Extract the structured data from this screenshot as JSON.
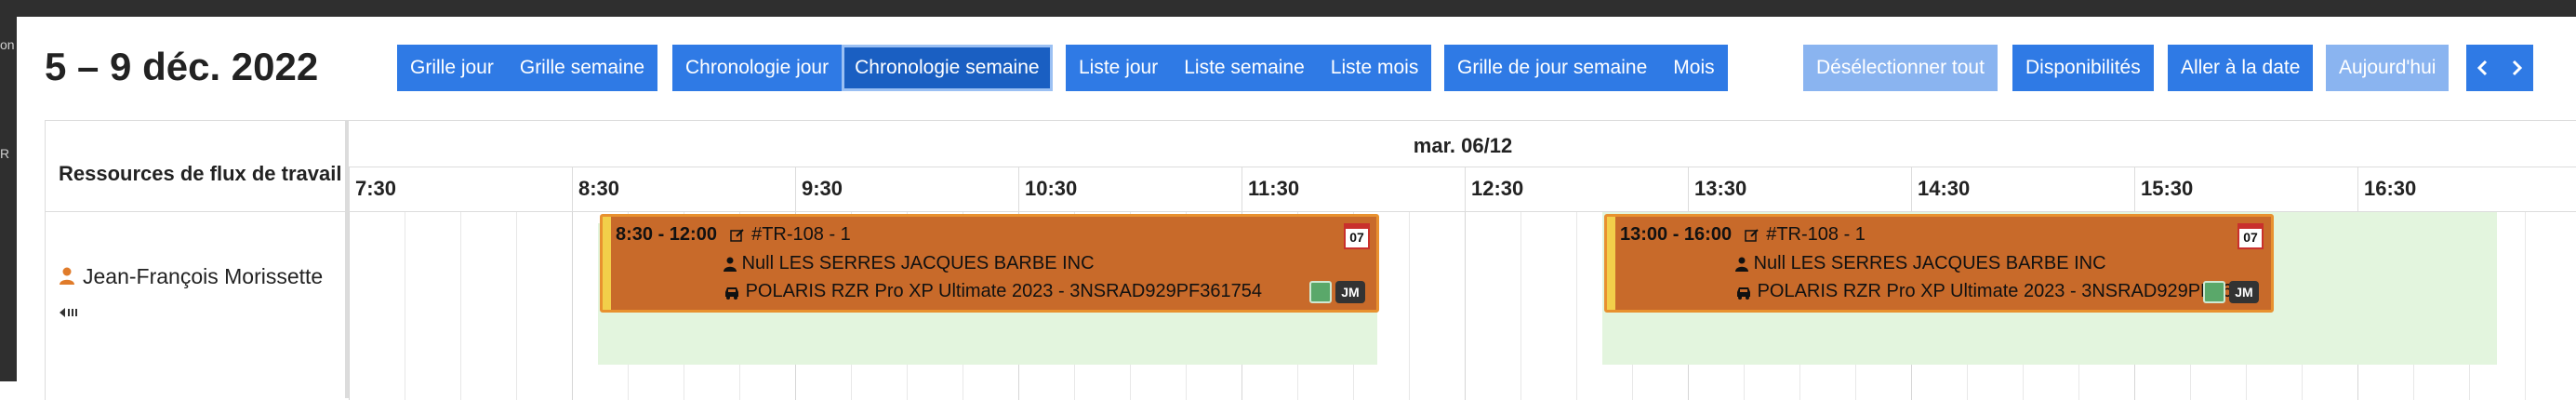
{
  "frame": {
    "left_text_top": "on",
    "left_text_mid": "R"
  },
  "header": {
    "title": "5 – 9 déc. 2022"
  },
  "toolbar": {
    "grille_jour": "Grille jour",
    "grille_semaine": "Grille semaine",
    "chrono_jour": "Chronologie jour",
    "chrono_semaine": "Chronologie semaine",
    "liste_jour": "Liste jour",
    "liste_semaine": "Liste semaine",
    "liste_mois": "Liste mois",
    "grille_jour_semaine": "Grille de jour semaine",
    "mois": "Mois",
    "deselect_all": "Désélectionner tout",
    "disponibilites": "Disponibilités",
    "aller_date": "Aller à la date",
    "aujourdhui": "Aujourd'hui",
    "prev_icon": "chevron-left-icon",
    "next_icon": "chevron-right-icon"
  },
  "calendar": {
    "resource_header": "Ressources de flux de travail",
    "day_label": "mar. 06/12",
    "hours": [
      "7:30",
      "8:30",
      "9:30",
      "10:30",
      "11:30",
      "12:30",
      "13:30",
      "14:30",
      "15:30",
      "16:30"
    ],
    "resource": {
      "name": "Jean-François Morissette",
      "icon": "user-icon",
      "sub_icon": "arrow-left-bars-icon"
    },
    "events": [
      {
        "time": "8:30 - 12:00",
        "ref": "#TR-108 - 1",
        "customer": "Null LES SERRES JACQUES BARBE INC",
        "vehicle": "POLARIS RZR Pro XP Ultimate 2023 - 3NSRAD929PF361754",
        "day_badge": "07",
        "initials": "JM"
      },
      {
        "time": "13:00 - 16:00",
        "ref": "#TR-108 - 1",
        "customer": "Null LES SERRES JACQUES BARBE INC",
        "vehicle": "POLARIS RZR Pro XP Ultimate 2023 - 3NSRAD929PF361754",
        "day_badge": "07",
        "initials": "JM"
      }
    ]
  },
  "colors": {
    "button_blue": "#2f7ae5",
    "button_active": "#1a5fc2",
    "button_light": "#8ab4f0",
    "event_bg": "#c86a2a",
    "availability": "#e3f5de"
  }
}
